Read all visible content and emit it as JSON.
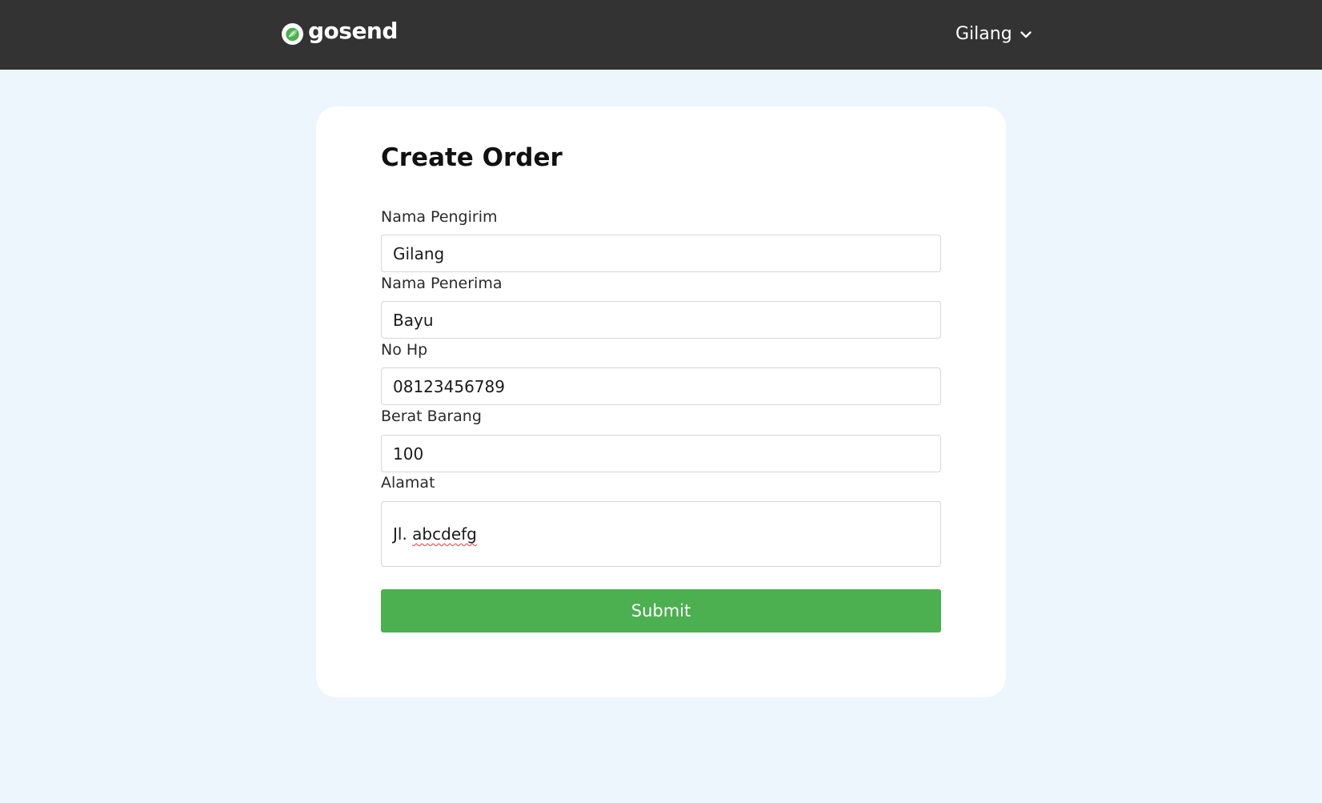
{
  "navbar": {
    "brand": "gosend",
    "logo_icon": "gosend-leaf-logo-icon",
    "user_name": "Gilang",
    "user_menu_icon": "chevron-down-icon"
  },
  "form": {
    "title": "Create Order",
    "fields": [
      {
        "label": "Nama Pengirim",
        "value": "Gilang"
      },
      {
        "label": "Nama Penerima",
        "value": "Bayu"
      },
      {
        "label": "No Hp",
        "value": "08123456789"
      },
      {
        "label": "Berat Barang",
        "value": "100"
      },
      {
        "label": "Alamat",
        "value_prefix": "Jl. ",
        "value_misspelled": "abcdefg"
      }
    ],
    "submit_label": "Submit"
  },
  "colors": {
    "navbar_bg": "#333333",
    "page_bg": "#eef6fd",
    "card_bg": "#ffffff",
    "submit_bg": "#4caf50",
    "logo_green": "#4caf50"
  }
}
